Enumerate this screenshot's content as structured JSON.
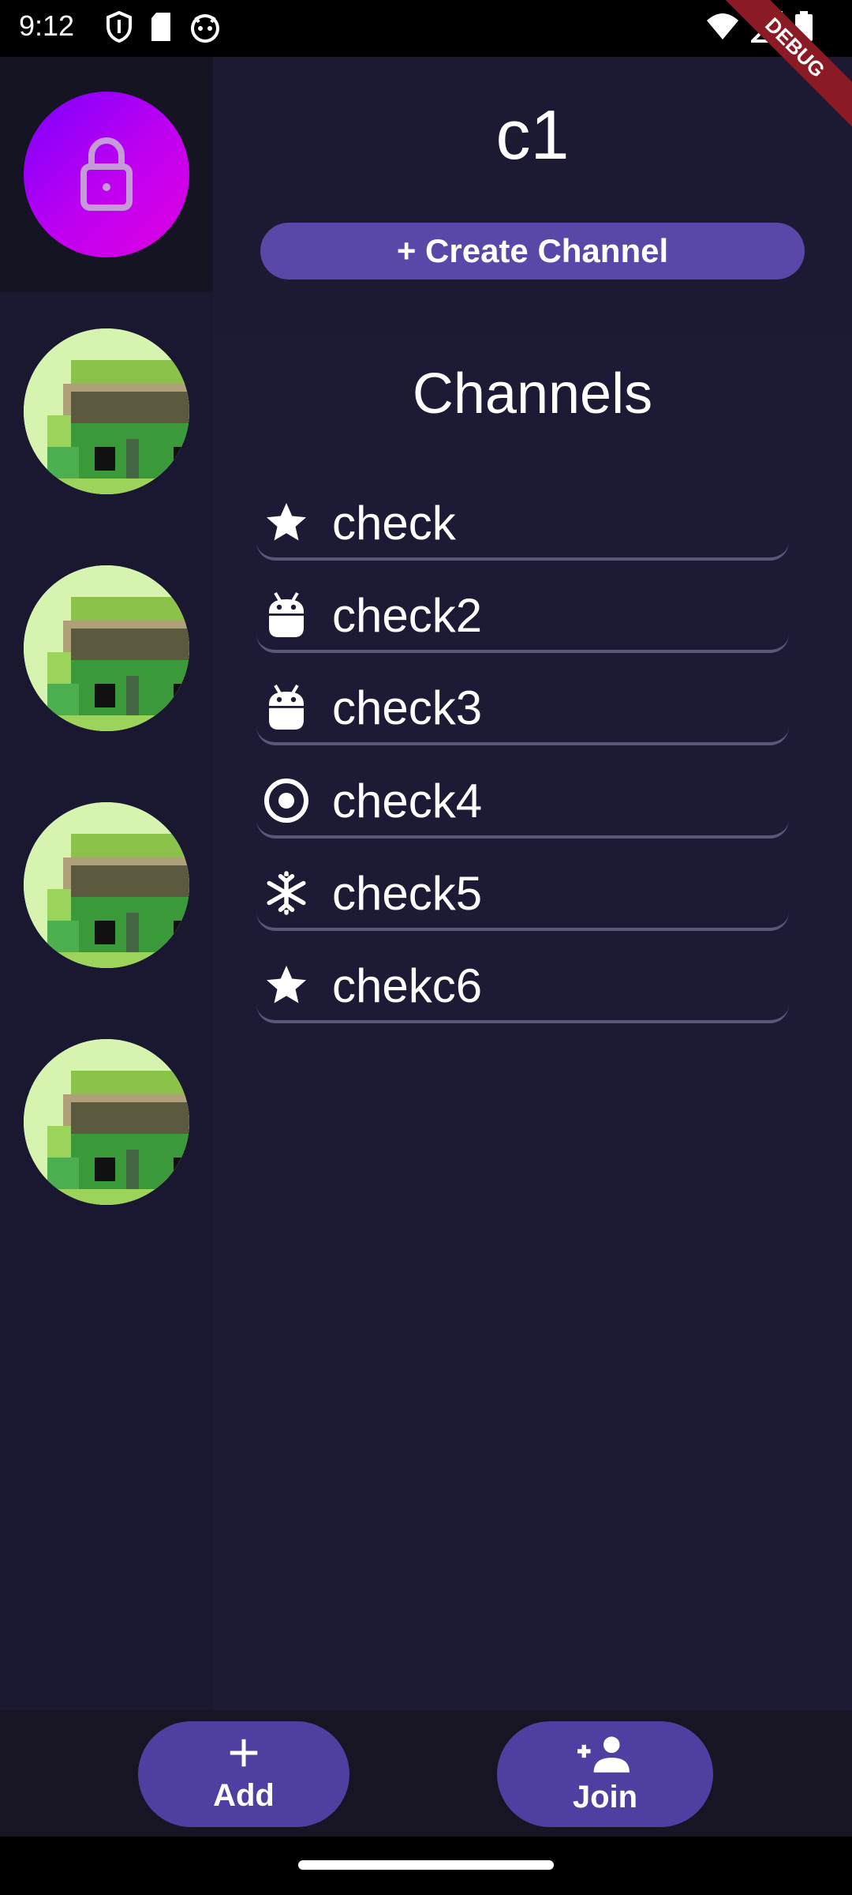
{
  "status_bar": {
    "time": "9:12",
    "left_icons": [
      "shield-icon",
      "sd-card-icon",
      "cat-icon"
    ],
    "right_icons": [
      "wifi-icon",
      "signal-icon",
      "battery-icon"
    ]
  },
  "debug_banner": "DEBUG",
  "sidebar": {
    "active_server_icon": "lock-icon",
    "server_count": 4
  },
  "header": {
    "server_name": "c1",
    "create_channel_label": "+ Create Channel"
  },
  "channels": {
    "title": "Channels",
    "items": [
      {
        "label": "check",
        "icon": "star-icon"
      },
      {
        "label": "check2",
        "icon": "android-icon"
      },
      {
        "label": "check3",
        "icon": "android-icon"
      },
      {
        "label": "check4",
        "icon": "radio-button-icon"
      },
      {
        "label": "check5",
        "icon": "snowflake-icon"
      },
      {
        "label": "chekc6",
        "icon": "star-icon"
      }
    ]
  },
  "bottom": {
    "add_label": "Add",
    "join_label": "Join"
  },
  "colors": {
    "background": "#1d1a36",
    "accent": "#5b47a8",
    "lock_gradient": [
      "#7b00ff",
      "#e000e0"
    ]
  }
}
